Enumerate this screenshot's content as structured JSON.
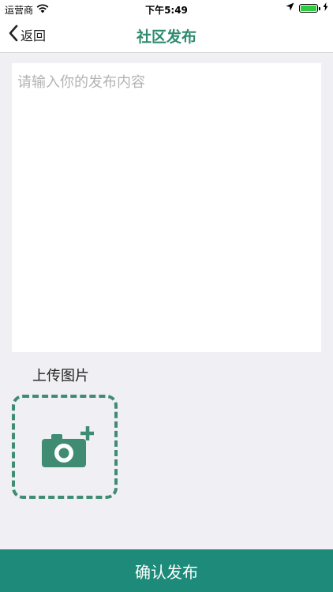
{
  "status_bar": {
    "carrier": "运营商",
    "time": "下午5:49",
    "battery_level": 1.0
  },
  "nav": {
    "back_label": "返回",
    "title": "社区发布"
  },
  "editor": {
    "placeholder": "请输入你的发布内容"
  },
  "upload": {
    "label": "上传图片",
    "icon": "camera-plus-icon"
  },
  "footer": {
    "confirm_label": "确认发布"
  },
  "colors": {
    "accent": "#2f8a6e",
    "confirm_bar": "#1d8a7a",
    "background": "#efeff4"
  }
}
